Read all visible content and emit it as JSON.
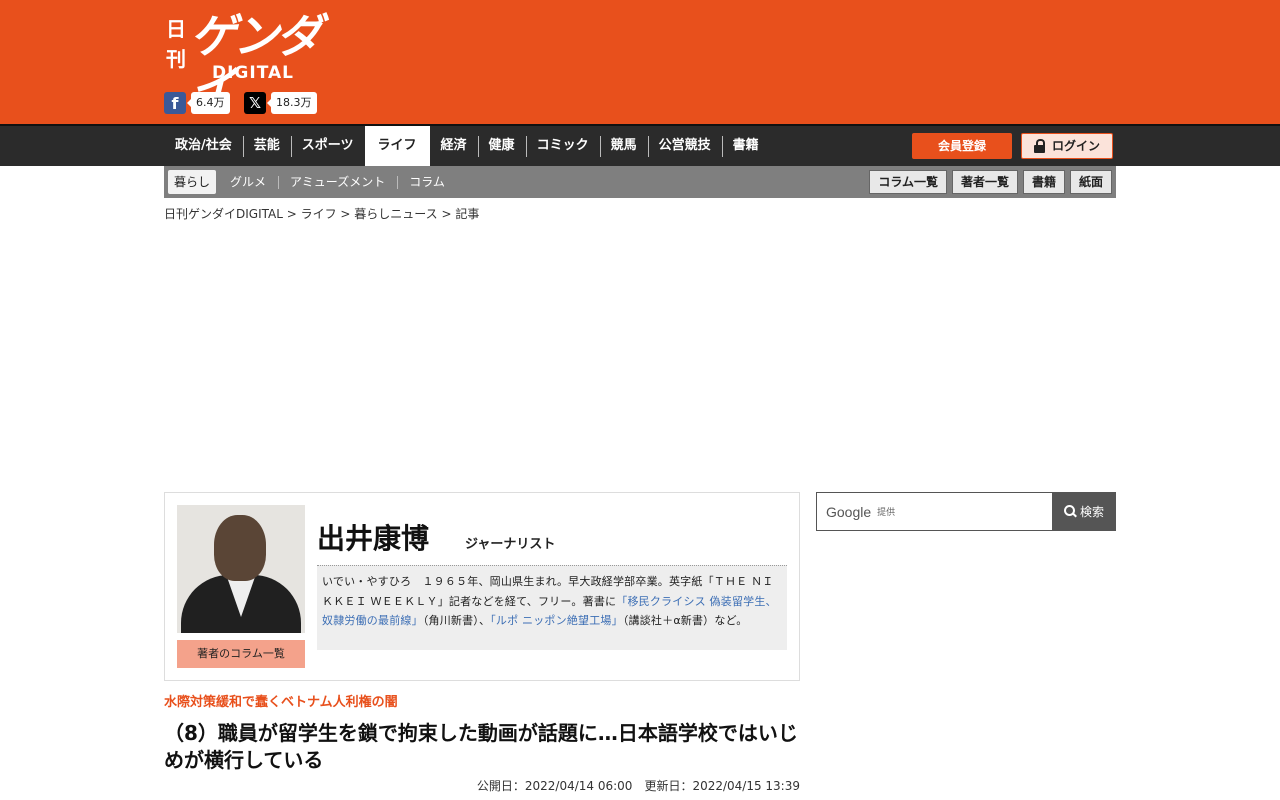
{
  "header": {
    "logo": {
      "nikkan": "日刊",
      "main": "ゲンダイ",
      "digital": "DIGITAL"
    },
    "social": {
      "facebook": {
        "icon": "f",
        "count": "6.4万"
      },
      "x": {
        "icon": "𝕏",
        "count": "18.3万"
      }
    },
    "brand_color": "#e8501c"
  },
  "nav": {
    "items": [
      {
        "label": "政治/社会"
      },
      {
        "label": "芸能"
      },
      {
        "label": "スポーツ"
      },
      {
        "label": "ライフ"
      },
      {
        "label": "経済"
      },
      {
        "label": "健康"
      },
      {
        "label": "コミック"
      },
      {
        "label": "競馬"
      },
      {
        "label": "公営競技"
      },
      {
        "label": "書籍"
      }
    ],
    "active": "ライフ",
    "register_label": "会員登録",
    "login_label": "ログイン"
  },
  "subnav": {
    "items": [
      {
        "label": "暮らし"
      },
      {
        "label": "グルメ"
      },
      {
        "label": "アミューズメント"
      },
      {
        "label": "コラム"
      }
    ],
    "active": "暮らし",
    "right_buttons": [
      {
        "label": "コラム一覧"
      },
      {
        "label": "著者一覧"
      },
      {
        "label": "書籍"
      },
      {
        "label": "紙面"
      }
    ]
  },
  "breadcrumb": "日刊ゲンダイDIGITAL > ライフ > 暮らしニュース > 記事",
  "author": {
    "name": "出井康博",
    "title": "ジャーナリスト",
    "columns_label": "著者のコラム一覧",
    "bio_1": "いでい・やすひろ　１９６５年、岡山県生まれ。早大政経学部卒業。英字紙「ＴＨＥ ＮＩＫＫＥＩ ＷＥＥＫＬＹ」記者などを経て、フリー。著書に",
    "bio_link_1": "「移民クライシス 偽装留学生、奴隷労働の最前線」",
    "bio_2": "（角川新書）、",
    "bio_link_2": "「ルポ ニッポン絶望工場」",
    "bio_3": "（講談社＋α新書）など。"
  },
  "search": {
    "google_label": "Google",
    "provided_label": "提供",
    "button_label": "検索"
  },
  "article": {
    "series": "水際対策緩和で蠢くベトナム人利権の闇",
    "title": "（8）職員が留学生を鎖で拘束した動画が話題に…日本語学校ではいじめが横行している",
    "published": "公開日：2022/04/14 06:00",
    "updated": "更新日：2022/04/15 13:39"
  }
}
